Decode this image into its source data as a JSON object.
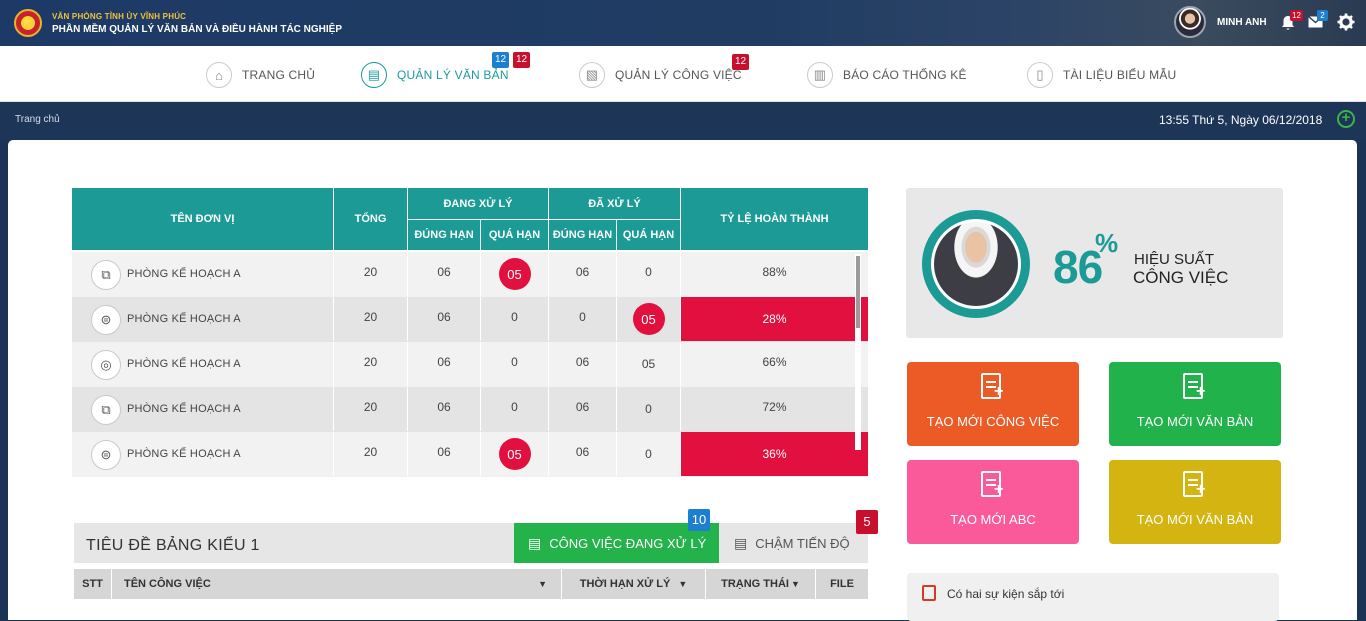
{
  "header": {
    "org_line1": "VĂN PHÒNG TỈNH ỦY VĨNH PHÚC",
    "org_line2": "PHẦN MỀM QUẢN LÝ VĂN BẢN VÀ ĐIỀU HÀNH TÁC NGHIỆP",
    "user_name": "MINH ANH",
    "notif_count": "12",
    "mail_count": "2"
  },
  "nav": {
    "items": [
      {
        "label": "TRANG CHỦ"
      },
      {
        "label": "QUẢN LÝ VĂN BẢN",
        "badge_blue": "12",
        "badge_red": "12"
      },
      {
        "label": "QUẢN LÝ CÔNG VIỆC",
        "badge_red": "12"
      },
      {
        "label": "BÁO CÁO THỐNG KÊ"
      },
      {
        "label": "TÀI LIỆU BIỂU MẪU"
      }
    ]
  },
  "breadcrumb": "Trang chủ",
  "datetime": "13:55 Thứ 5, Ngày 06/12/2018",
  "table": {
    "headers": {
      "unit": "TÊN ĐƠN VỊ",
      "total": "TỔNG",
      "processing": "ĐANG XỬ LÝ",
      "processed": "ĐÃ XỬ LÝ",
      "on_time": "ĐÚNG HẠN",
      "overdue": "QUÁ HẠN",
      "rate": "TỶ LỆ HOÀN THÀNH"
    },
    "rows": [
      {
        "unit": "PHÒNG KẾ HOẠCH A",
        "total": "20",
        "p_on": "06",
        "p_over": "05",
        "d_on": "06",
        "d_over": "0",
        "rate": "88%"
      },
      {
        "unit": "PHÒNG KẾ HOẠCH A",
        "total": "20",
        "p_on": "06",
        "p_over": "0",
        "d_on": "0",
        "d_over": "05",
        "rate": "28%"
      },
      {
        "unit": "PHÒNG KẾ HOẠCH A",
        "total": "20",
        "p_on": "06",
        "p_over": "0",
        "d_on": "06",
        "d_over": "05",
        "rate": "66%"
      },
      {
        "unit": "PHÒNG KẾ HOẠCH A",
        "total": "20",
        "p_on": "06",
        "p_over": "0",
        "d_on": "06",
        "d_over": "0",
        "rate": "72%"
      },
      {
        "unit": "PHÒNG KẾ HOẠCH A",
        "total": "20",
        "p_on": "06",
        "p_over": "05",
        "d_on": "06",
        "d_over": "0",
        "rate": "36%"
      }
    ]
  },
  "subtable": {
    "title": "TIÊU ĐỀ BẢNG KIỂU 1",
    "tab_active": "CÔNG VIỆC ĐANG  XỬ LÝ",
    "tab_active_count": "10",
    "tab_other": "CHẬM TIẾN ĐỘ",
    "tab_other_count": "5",
    "columns": [
      "STT",
      "TÊN CÔNG VIỆC",
      "THỜI HẠN XỬ LÝ",
      "TRẠNG THÁI",
      "FILE"
    ]
  },
  "performance": {
    "value": "86",
    "percent_sign": "%",
    "label1": "HIỆU SUẤT",
    "label2": "CÔNG VIỆC"
  },
  "actions": [
    {
      "label": "TẠO MỚI CÔNG VIỆC",
      "color": "#ec5a25"
    },
    {
      "label": "TẠO MỚI VĂN BẢN",
      "color": "#22b24c"
    },
    {
      "label": "TẠO MỚI ABC",
      "color": "#fb5a9a"
    },
    {
      "label": "TẠO MỚI VĂN BẢN",
      "color": "#d4b410"
    }
  ],
  "events": {
    "text": "Có hai sự kiện sắp tới"
  },
  "colors": {
    "teal": "#1b9a96",
    "alert_red": "#e2103f",
    "navy": "#1d3557"
  }
}
